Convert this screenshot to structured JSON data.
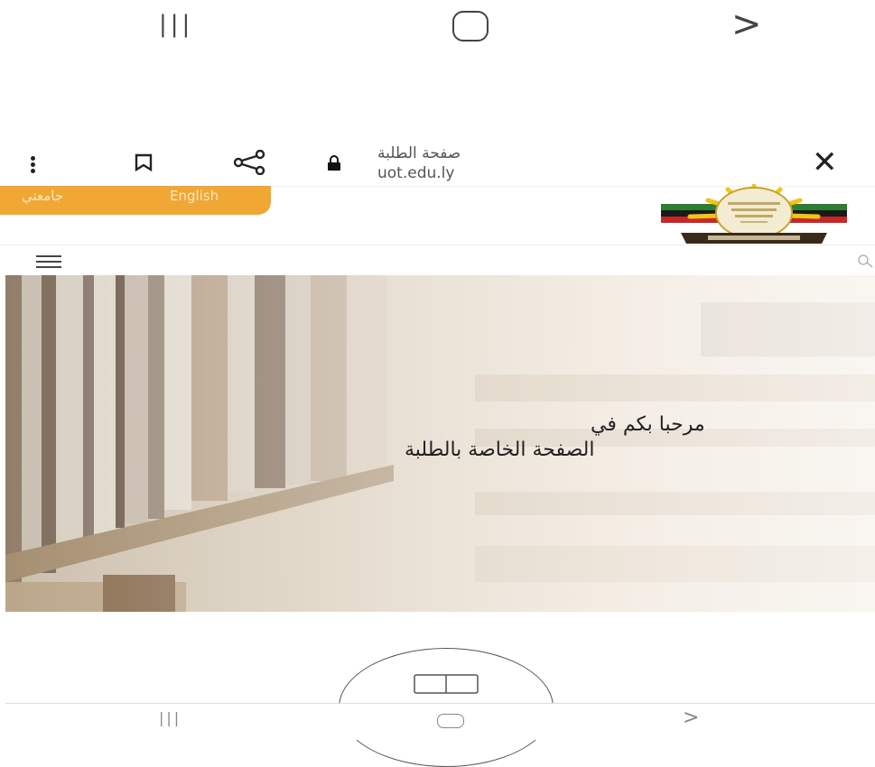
{
  "system_nav": {
    "recent_icon": "recent-apps-icon",
    "home_icon": "home-icon",
    "back_icon": "back-icon",
    "recent_glyph": "|||",
    "back_glyph": ">"
  },
  "browser": {
    "page_title": "صفحة الطلبة",
    "url": "uot.edu.ly",
    "close_glyph": "✕",
    "icons": [
      "more-menu-icon",
      "bookmark-icon",
      "share-icon",
      "lock-icon",
      "close-icon"
    ]
  },
  "header": {
    "links": [
      "جامعتي",
      "English"
    ],
    "accent": "#f0a734",
    "logo_icon": "university-logo"
  },
  "nav": {
    "menu_icon": "hamburger-menu-icon",
    "search_icon": "search-icon"
  },
  "hero": {
    "line1": "مرحبا بكم في",
    "line2": "الصفحة الخاصة بالطلبة"
  },
  "reader": {
    "icon": "reader-mode-icon"
  },
  "bottom_nav": {
    "recent_glyph": "|||",
    "back_glyph": ">"
  }
}
